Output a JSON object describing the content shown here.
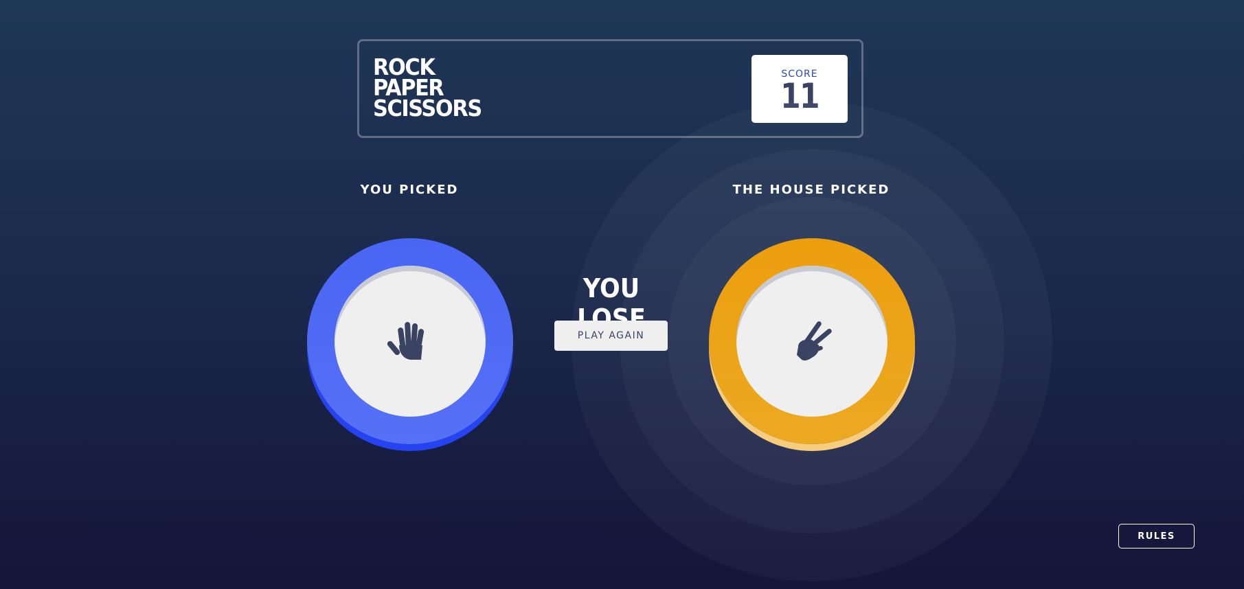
{
  "app": {
    "title_lines": [
      "ROCK",
      "PAPER",
      "SCISSORS"
    ]
  },
  "score": {
    "label": "SCORE",
    "value": "11"
  },
  "player": {
    "label": "YOU PICKED",
    "choice": "paper",
    "icon": "paper-hand-icon",
    "color": "#4865f4"
  },
  "house": {
    "label": "THE HOUSE PICKED",
    "choice": "scissors",
    "icon": "scissors-hand-icon",
    "color": "#ec9e0e"
  },
  "result": {
    "text": "YOU LOSE",
    "play_again_label": "PLAY AGAIN"
  },
  "footer": {
    "rules_label": "RULES"
  },
  "colors": {
    "background_top": "#1f3756",
    "background_bottom": "#141539",
    "header_border": "#606e85",
    "dark_text": "#3b4363",
    "score_label": "#2a46c0"
  }
}
